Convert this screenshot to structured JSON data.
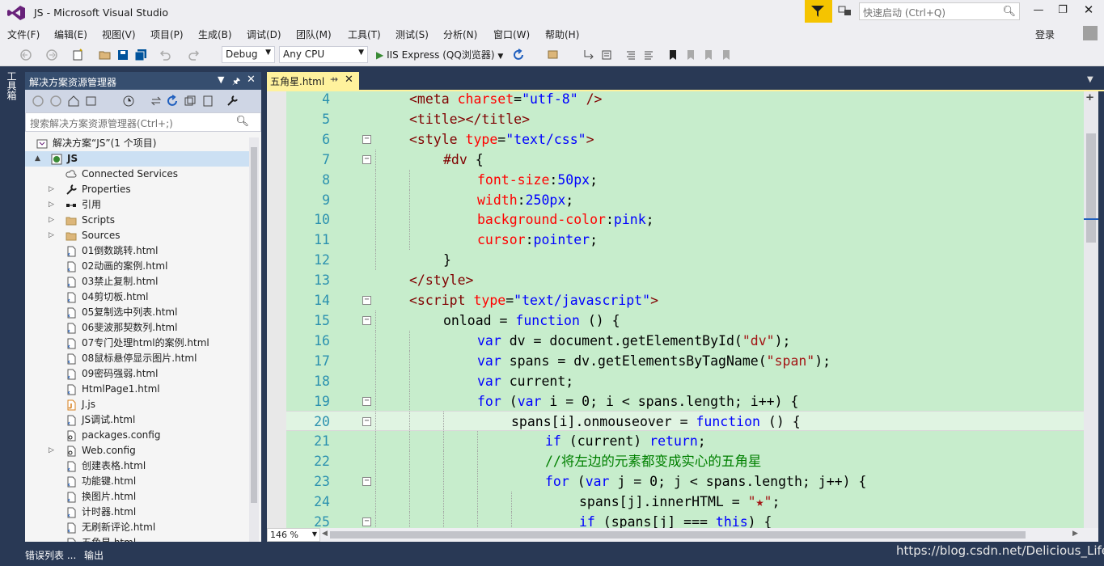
{
  "title": {
    "app_title": "JS - Microsoft Visual Studio",
    "quicklaunch_placeholder": "快速启动 (Ctrl+Q)"
  },
  "menu": [
    "文件(F)",
    "编辑(E)",
    "视图(V)",
    "项目(P)",
    "生成(B)",
    "调试(D)",
    "团队(M)",
    "工具(T)",
    "测试(S)",
    "分析(N)",
    "窗口(W)",
    "帮助(H)"
  ],
  "login_label": "登录",
  "toolbar": {
    "config": "Debug",
    "platform": "Any CPU",
    "run_target": "IIS Express (QQ浏览器)"
  },
  "toolbox_label": "工具箱",
  "solution_explorer": {
    "title": "解决方案资源管理器",
    "search_placeholder": "搜索解决方案资源管理器(Ctrl+;)",
    "items": [
      {
        "label": "解决方案“JS”(1 个项目)",
        "level": 0,
        "icon": "solution-icon",
        "arrow": ""
      },
      {
        "label": "JS",
        "level": 0,
        "icon": "web-project-icon",
        "arrow": "▲",
        "selected": true
      },
      {
        "label": "Connected Services",
        "level": 1,
        "icon": "cloud-service-icon",
        "arrow": ""
      },
      {
        "label": "Properties",
        "level": 1,
        "icon": "wrench-icon",
        "arrow": "▷"
      },
      {
        "label": "引用",
        "level": 1,
        "icon": "references-icon",
        "arrow": "▷"
      },
      {
        "label": "Scripts",
        "level": 1,
        "icon": "folder-icon",
        "arrow": "▷"
      },
      {
        "label": "Sources",
        "level": 1,
        "icon": "folder-icon",
        "arrow": "▷"
      },
      {
        "label": "01倒数跳转.html",
        "level": 1,
        "icon": "html-file-icon",
        "arrow": ""
      },
      {
        "label": "02动画的案例.html",
        "level": 1,
        "icon": "html-file-icon",
        "arrow": ""
      },
      {
        "label": "03禁止复制.html",
        "level": 1,
        "icon": "html-file-icon",
        "arrow": ""
      },
      {
        "label": "04剪切板.html",
        "level": 1,
        "icon": "html-file-icon",
        "arrow": ""
      },
      {
        "label": "05复制选中列表.html",
        "level": 1,
        "icon": "html-file-icon",
        "arrow": ""
      },
      {
        "label": "06斐波那契数列.html",
        "level": 1,
        "icon": "html-file-icon",
        "arrow": ""
      },
      {
        "label": "07专门处理html的案例.html",
        "level": 1,
        "icon": "html-file-icon",
        "arrow": ""
      },
      {
        "label": "08鼠标悬停显示图片.html",
        "level": 1,
        "icon": "html-file-icon",
        "arrow": ""
      },
      {
        "label": "09密码强弱.html",
        "level": 1,
        "icon": "html-file-icon",
        "arrow": ""
      },
      {
        "label": "HtmlPage1.html",
        "level": 1,
        "icon": "html-file-icon",
        "arrow": ""
      },
      {
        "label": "J.js",
        "level": 1,
        "icon": "js-file-icon",
        "arrow": ""
      },
      {
        "label": "JS调试.html",
        "level": 1,
        "icon": "html-file-icon",
        "arrow": ""
      },
      {
        "label": "packages.config",
        "level": 1,
        "icon": "config-file-icon",
        "arrow": ""
      },
      {
        "label": "Web.config",
        "level": 1,
        "icon": "config-file-icon",
        "arrow": "▷"
      },
      {
        "label": "创建表格.html",
        "level": 1,
        "icon": "html-file-icon",
        "arrow": ""
      },
      {
        "label": "功能键.html",
        "level": 1,
        "icon": "html-file-icon",
        "arrow": ""
      },
      {
        "label": "换图片.html",
        "level": 1,
        "icon": "html-file-icon",
        "arrow": ""
      },
      {
        "label": "计时器.html",
        "level": 1,
        "icon": "html-file-icon",
        "arrow": ""
      },
      {
        "label": "无刷新评论.html",
        "level": 1,
        "icon": "html-file-icon",
        "arrow": ""
      },
      {
        "label": "五角星.html",
        "level": 1,
        "icon": "html-file-icon",
        "arrow": ""
      }
    ]
  },
  "editor": {
    "tab_label": "五角星.html",
    "zoom": "146 %",
    "lines": [
      {
        "n": "4",
        "fold": false,
        "html": "<span class='t'>&lt;meta</span> <span class='a'>charset</span>=<span class='v'>\"utf-8\"</span> <span class='t'>/&gt;</span>",
        "indent": 0
      },
      {
        "n": "5",
        "fold": false,
        "html": "<span class='t'>&lt;title&gt;&lt;/title&gt;</span>",
        "indent": 0
      },
      {
        "n": "6",
        "fold": true,
        "html": "<span class='t'>&lt;style</span> <span class='a'>type</span>=<span class='v'>\"text/css\"</span><span class='t'>&gt;</span>",
        "indent": 0
      },
      {
        "n": "7",
        "fold": true,
        "html": "<span class='t'>#dv</span> {",
        "indent": 1
      },
      {
        "n": "8",
        "fold": false,
        "html": "<span class='a'>font-size</span>:<span class='v'>50px</span>;",
        "indent": 2
      },
      {
        "n": "9",
        "fold": false,
        "html": "<span class='a'>width</span>:<span class='v'>250px</span>;",
        "indent": 2
      },
      {
        "n": "10",
        "fold": false,
        "html": "<span class='a'>background-color</span>:<span class='v'>pink</span>;",
        "indent": 2
      },
      {
        "n": "11",
        "fold": false,
        "html": "<span class='a'>cursor</span>:<span class='v'>pointer</span>;",
        "indent": 2
      },
      {
        "n": "12",
        "fold": false,
        "html": "}",
        "indent": 1
      },
      {
        "n": "13",
        "fold": false,
        "html": "<span class='t'>&lt;/style&gt;</span>",
        "indent": 0
      },
      {
        "n": "14",
        "fold": true,
        "html": "<span class='t'>&lt;script</span> <span class='a'>type</span>=<span class='v'>\"text/javascript\"</span><span class='t'>&gt;</span>",
        "indent": 0
      },
      {
        "n": "15",
        "fold": true,
        "html": "onload = <span class='k'>function</span> () {",
        "indent": 1
      },
      {
        "n": "16",
        "fold": false,
        "html": "<span class='k'>var</span> dv = document.getElementById(<span class='s'>\"dv\"</span>);",
        "indent": 2
      },
      {
        "n": "17",
        "fold": false,
        "html": "<span class='k'>var</span> spans = dv.getElementsByTagName(<span class='s'>\"span\"</span>);",
        "indent": 2
      },
      {
        "n": "18",
        "fold": false,
        "html": "<span class='k'>var</span> current;",
        "indent": 2
      },
      {
        "n": "19",
        "fold": true,
        "html": "<span class='k'>for</span> (<span class='k'>var</span> i = 0; i &lt; spans.length; i++) {",
        "indent": 2
      },
      {
        "n": "20",
        "fold": true,
        "html": "spans[i].onmouseover = <span class='k'>function</span> () {",
        "indent": 3,
        "current": true
      },
      {
        "n": "21",
        "fold": false,
        "html": "<span class='k'>if</span> (current) <span class='k'>return</span>;",
        "indent": 4
      },
      {
        "n": "22",
        "fold": false,
        "html": "<span class='c'>//将左边的元素都变成实心的五角星</span>",
        "indent": 4
      },
      {
        "n": "23",
        "fold": true,
        "html": "<span class='k'>for</span> (<span class='k'>var</span> j = 0; j &lt; spans.length; j++) {",
        "indent": 4
      },
      {
        "n": "24",
        "fold": false,
        "html": "spans[j].innerHTML = <span class='s'>\"★\"</span>;",
        "indent": 5
      },
      {
        "n": "25",
        "fold": true,
        "html": "<span class='k'>if</span> (spans[j] === <span class='k'>this</span>) {",
        "indent": 5
      }
    ]
  },
  "bottom_tabs": [
    "错误列表 ...",
    "输出"
  ],
  "watermark": "https://blog.csdn.net/Delicious_Life"
}
